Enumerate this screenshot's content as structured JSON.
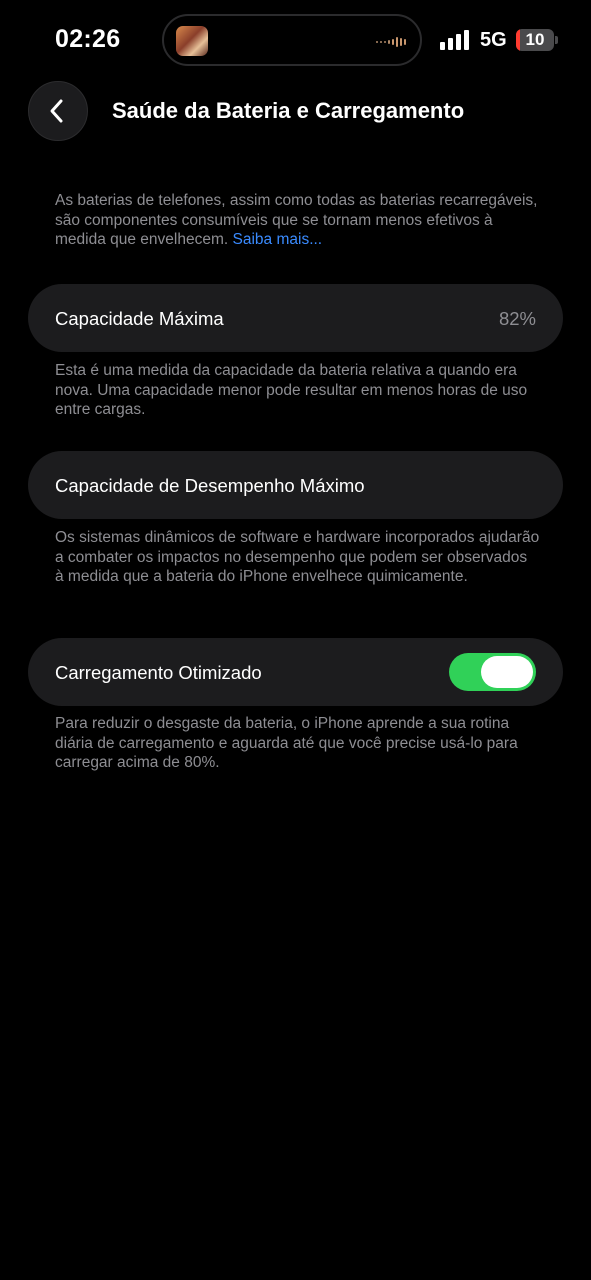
{
  "status_bar": {
    "time": "02:26",
    "network": "5G",
    "battery_percent": "10",
    "battery_level": 0.1,
    "battery_color": "#ff3b30",
    "signal_bars": 4
  },
  "header": {
    "back_icon": "chevron-left-icon",
    "title": "Saúde da Bateria e Carregamento"
  },
  "intro": {
    "text": "As baterias de telefones, assim como todas as baterias recarregáveis, são componentes consumíveis que se tornam menos efetivos à medida que envelhecem. ",
    "link": "Saiba mais..."
  },
  "max_capacity": {
    "label": "Capacidade Máxima",
    "value": "82%",
    "description": "Esta é uma medida da capacidade da bateria relativa a quando era nova. Uma capacidade menor pode resultar em menos horas de uso entre cargas."
  },
  "peak_performance": {
    "label": "Capacidade de Desempenho Máximo",
    "description": "Os sistemas dinâmicos de software e hardware incorporados ajudarão a combater os impactos no desempenho que podem ser observados à medida que a bateria do iPhone envelhece quimicamente."
  },
  "optimized_charging": {
    "label": "Carregamento Otimizado",
    "enabled": true,
    "toggle_color": "#30d158",
    "description": "Para reduzir o desgaste da bateria, o iPhone aprende a sua rotina diária de carregamento e aguarda até que você precise usá-lo para carregar acima de 80%."
  },
  "colors": {
    "background": "#000000",
    "card": "#1c1c1e",
    "secondary_text": "#8e8e93",
    "link": "#3a8bff"
  }
}
